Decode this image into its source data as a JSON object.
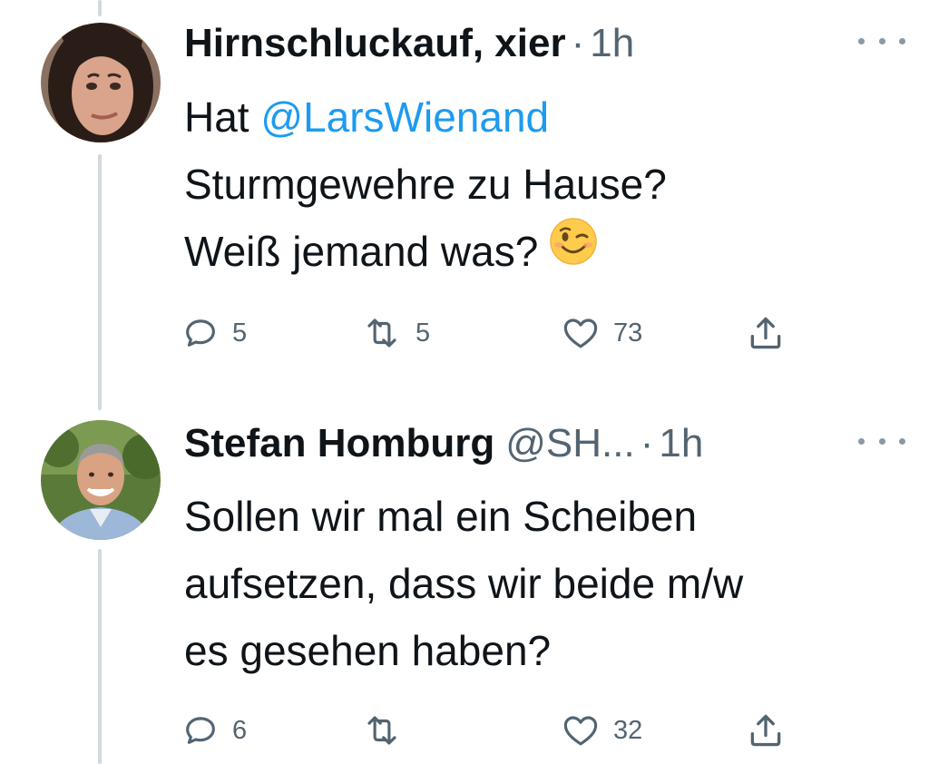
{
  "thread": {
    "tweets": [
      {
        "display_name": "Hirnschluckauf, xier",
        "handle": "",
        "separator": "·",
        "time": "1h",
        "text_prefix": "Hat ",
        "mention": "@LarsWienand",
        "text_line2": "Sturmgewehre zu Hause?",
        "text_line3": "Weiß jemand was?",
        "emoji": "winking-face",
        "replies": "5",
        "retweets": "5",
        "likes": "73"
      },
      {
        "display_name": "Stefan Homburg",
        "handle": "@SH...",
        "separator": "·",
        "time": "1h",
        "text_line1": "Sollen wir mal ein Scheiben",
        "text_line2": "aufsetzen, dass wir beide m/w",
        "text_line3": "es gesehen haben?",
        "replies": "6",
        "retweets": "",
        "likes": "32"
      }
    ]
  },
  "icons": {
    "reply": "reply-icon",
    "retweet": "retweet-icon",
    "like": "heart-icon",
    "share": "share-icon",
    "more": "more-icon"
  },
  "colors": {
    "mention": "#1d9bf0",
    "secondary_text": "#536471",
    "thread_line": "#cfd9de"
  }
}
